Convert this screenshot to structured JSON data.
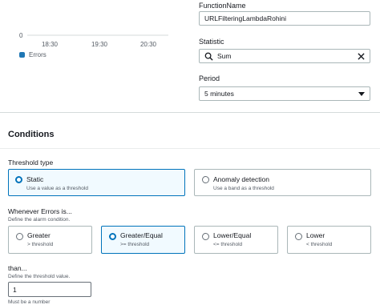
{
  "chart": {
    "y_tick": "0",
    "x_ticks": [
      "18:30",
      "19:30",
      "20:30"
    ],
    "legend": {
      "label": "Errors",
      "color": "#1f77b4"
    }
  },
  "chart_data": {
    "type": "line",
    "x_tick_labels": [
      "18:30",
      "19:30",
      "20:30"
    ],
    "y_tick_labels": [
      "0"
    ],
    "series": [
      {
        "name": "Errors",
        "color": "#1f77b4",
        "values": []
      }
    ],
    "legend_placement": "bottom-left"
  },
  "function_name": {
    "label": "FunctionName",
    "value": "URLFilteringLambdaRohini"
  },
  "statistic": {
    "label": "Statistic",
    "value": "Sum"
  },
  "period": {
    "label": "Period",
    "value": "5 minutes"
  },
  "conditions": {
    "title": "Conditions",
    "threshold_type": {
      "label": "Threshold type",
      "options": [
        {
          "title": "Static",
          "desc": "Use a value as a threshold",
          "selected": true
        },
        {
          "title": "Anomaly detection",
          "desc": "Use a band as a threshold",
          "selected": false
        }
      ]
    },
    "whenever": {
      "label": "Whenever Errors is...",
      "desc": "Define the alarm condition.",
      "options": [
        {
          "title": "Greater",
          "desc": "> threshold",
          "selected": false
        },
        {
          "title": "Greater/Equal",
          "desc": ">= threshold",
          "selected": true
        },
        {
          "title": "Lower/Equal",
          "desc": "<= threshold",
          "selected": false
        },
        {
          "title": "Lower",
          "desc": "< threshold",
          "selected": false
        }
      ]
    },
    "than": {
      "label": "than...",
      "desc": "Define the threshold value.",
      "value": "1",
      "hint": "Must be a number"
    }
  },
  "colors": {
    "accent": "#0073bb",
    "selected_bg": "#f1faff"
  }
}
